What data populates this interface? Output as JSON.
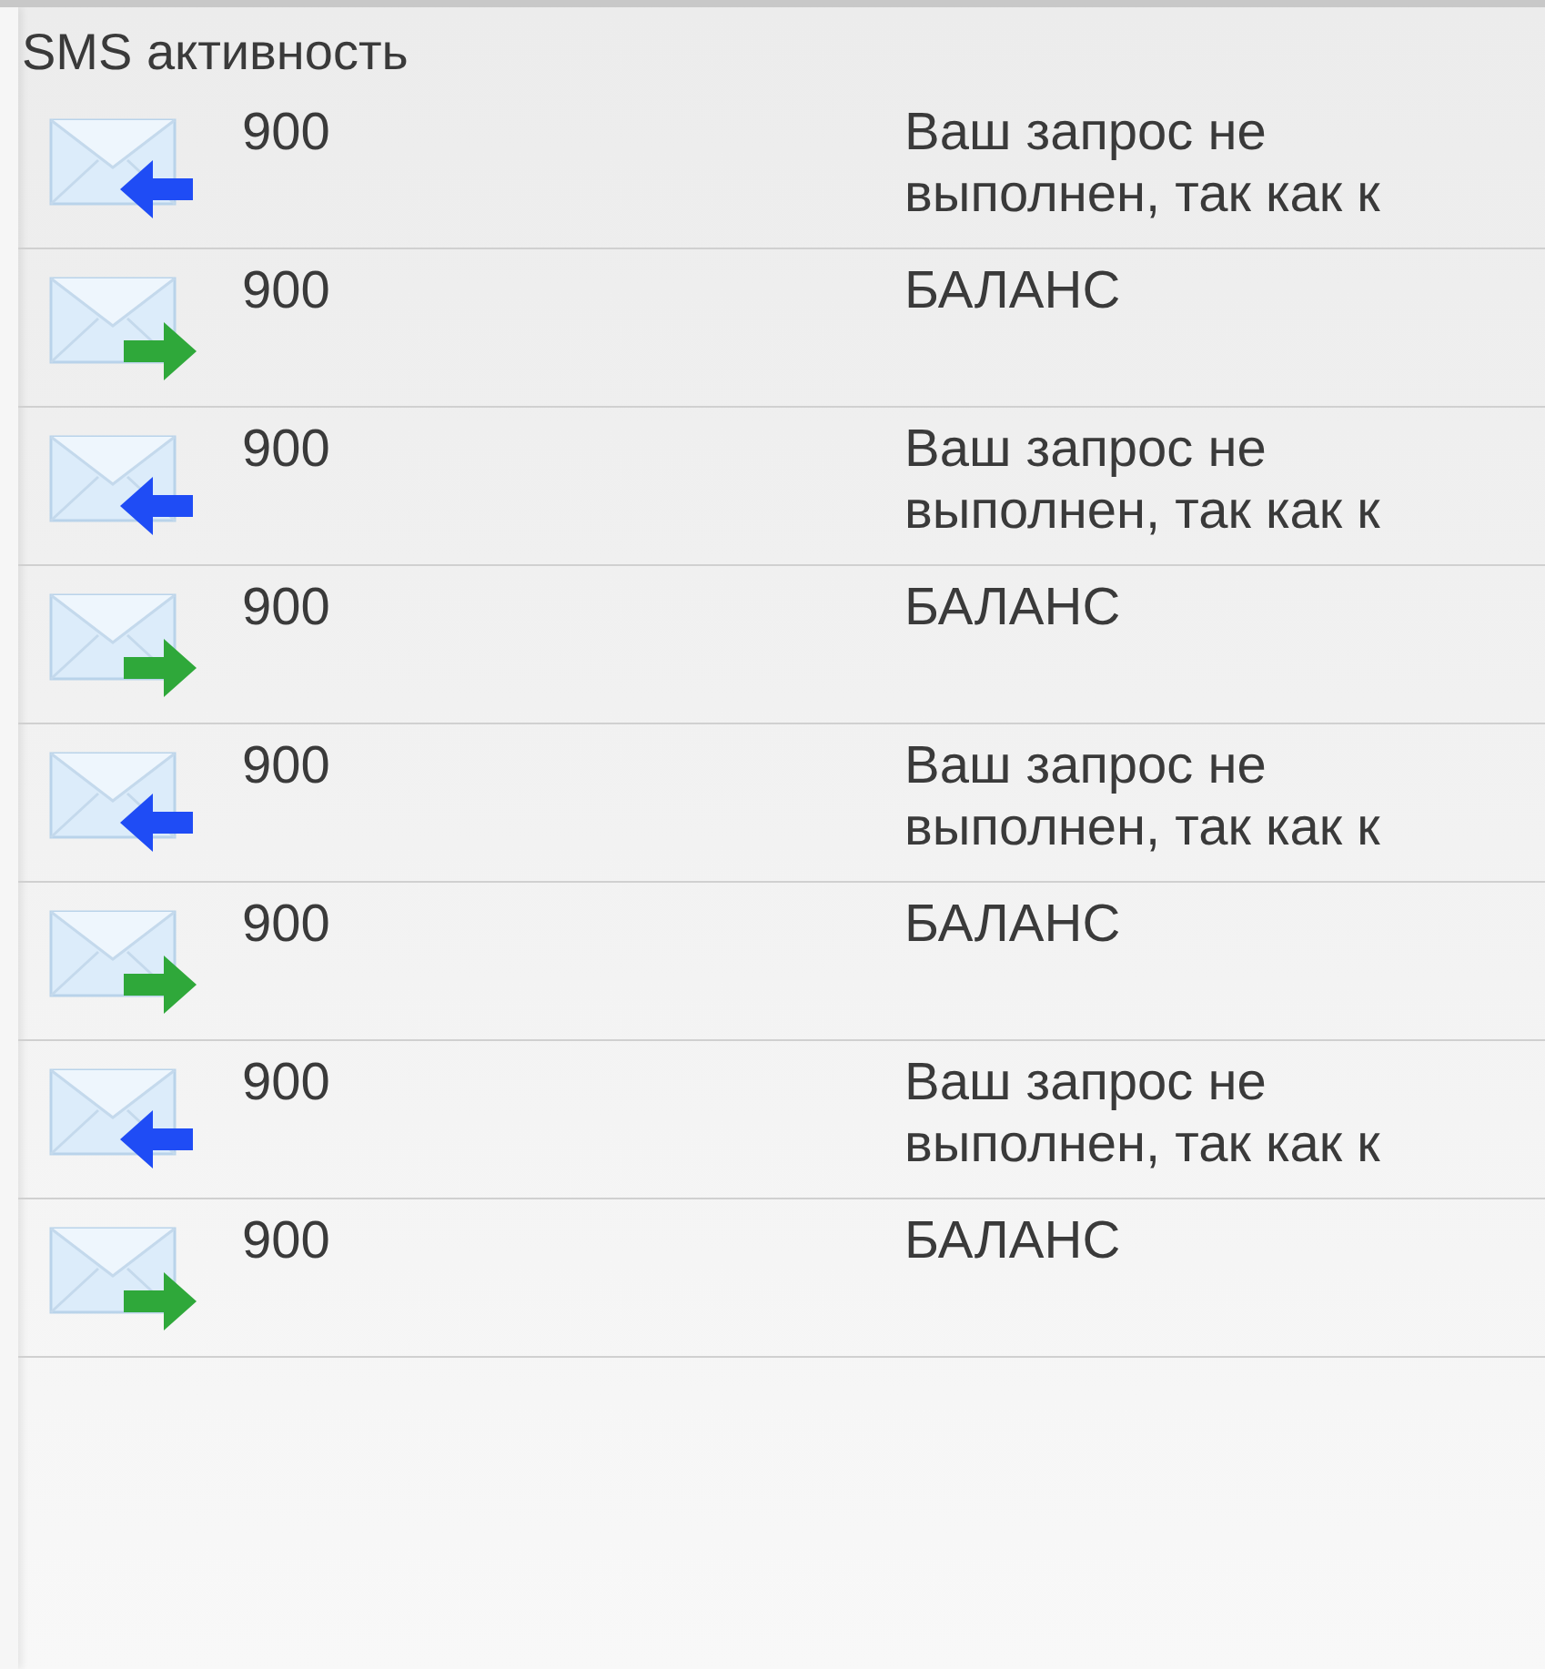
{
  "title": "SMS активность",
  "messages": [
    {
      "kind": "incoming",
      "number": "900",
      "text": "Ваш запрос не выполнен, так как к"
    },
    {
      "kind": "outgoing",
      "number": "900",
      "text": "БАЛАНС"
    },
    {
      "kind": "incoming",
      "number": "900",
      "text": "Ваш запрос не выполнен, так как к"
    },
    {
      "kind": "outgoing",
      "number": "900",
      "text": "БАЛАНС"
    },
    {
      "kind": "incoming",
      "number": "900",
      "text": "Ваш запрос не выполнен, так как к"
    },
    {
      "kind": "outgoing",
      "number": "900",
      "text": "БАЛАНС"
    },
    {
      "kind": "incoming",
      "number": "900",
      "text": "Ваш запрос не выполнен, так как к"
    },
    {
      "kind": "outgoing",
      "number": "900",
      "text": "БАЛАНС"
    }
  ]
}
